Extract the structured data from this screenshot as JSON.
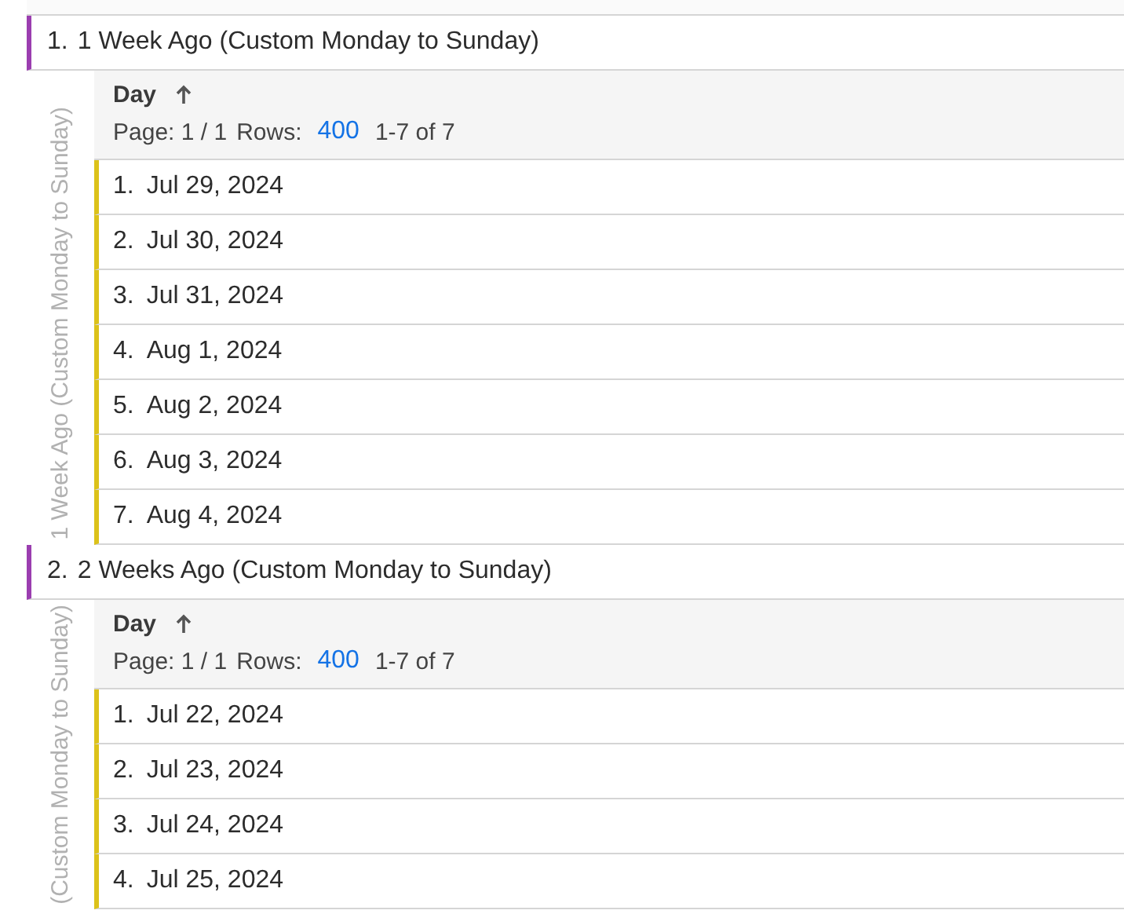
{
  "groups": [
    {
      "rank": "1.",
      "title": "1 Week Ago (Custom Monday to Sunday)",
      "side_label": "1 Week Ago (Custom Monday to Sunday)",
      "column": "Day",
      "sort_ascending": true,
      "page": "Page: 1 / 1",
      "rows_label": "Rows:",
      "rows_value": "400",
      "range": "1-7 of 7",
      "rows": [
        {
          "rank": "1.",
          "date": "Jul 29, 2024"
        },
        {
          "rank": "2.",
          "date": "Jul 30, 2024"
        },
        {
          "rank": "3.",
          "date": "Jul 31, 2024"
        },
        {
          "rank": "4.",
          "date": "Aug 1, 2024"
        },
        {
          "rank": "5.",
          "date": "Aug 2, 2024"
        },
        {
          "rank": "6.",
          "date": "Aug 3, 2024"
        },
        {
          "rank": "7.",
          "date": "Aug 4, 2024"
        }
      ]
    },
    {
      "rank": "2.",
      "title": "2 Weeks Ago (Custom Monday to Sunday)",
      "side_label": "(Custom Monday to Sunday)",
      "column": "Day",
      "sort_ascending": true,
      "page": "Page: 1 / 1",
      "rows_label": "Rows:",
      "rows_value": "400",
      "range": "1-7 of 7",
      "rows": [
        {
          "rank": "1.",
          "date": "Jul 22, 2024"
        },
        {
          "rank": "2.",
          "date": "Jul 23, 2024"
        },
        {
          "rank": "3.",
          "date": "Jul 24, 2024"
        },
        {
          "rank": "4.",
          "date": "Jul 25, 2024"
        }
      ]
    }
  ]
}
